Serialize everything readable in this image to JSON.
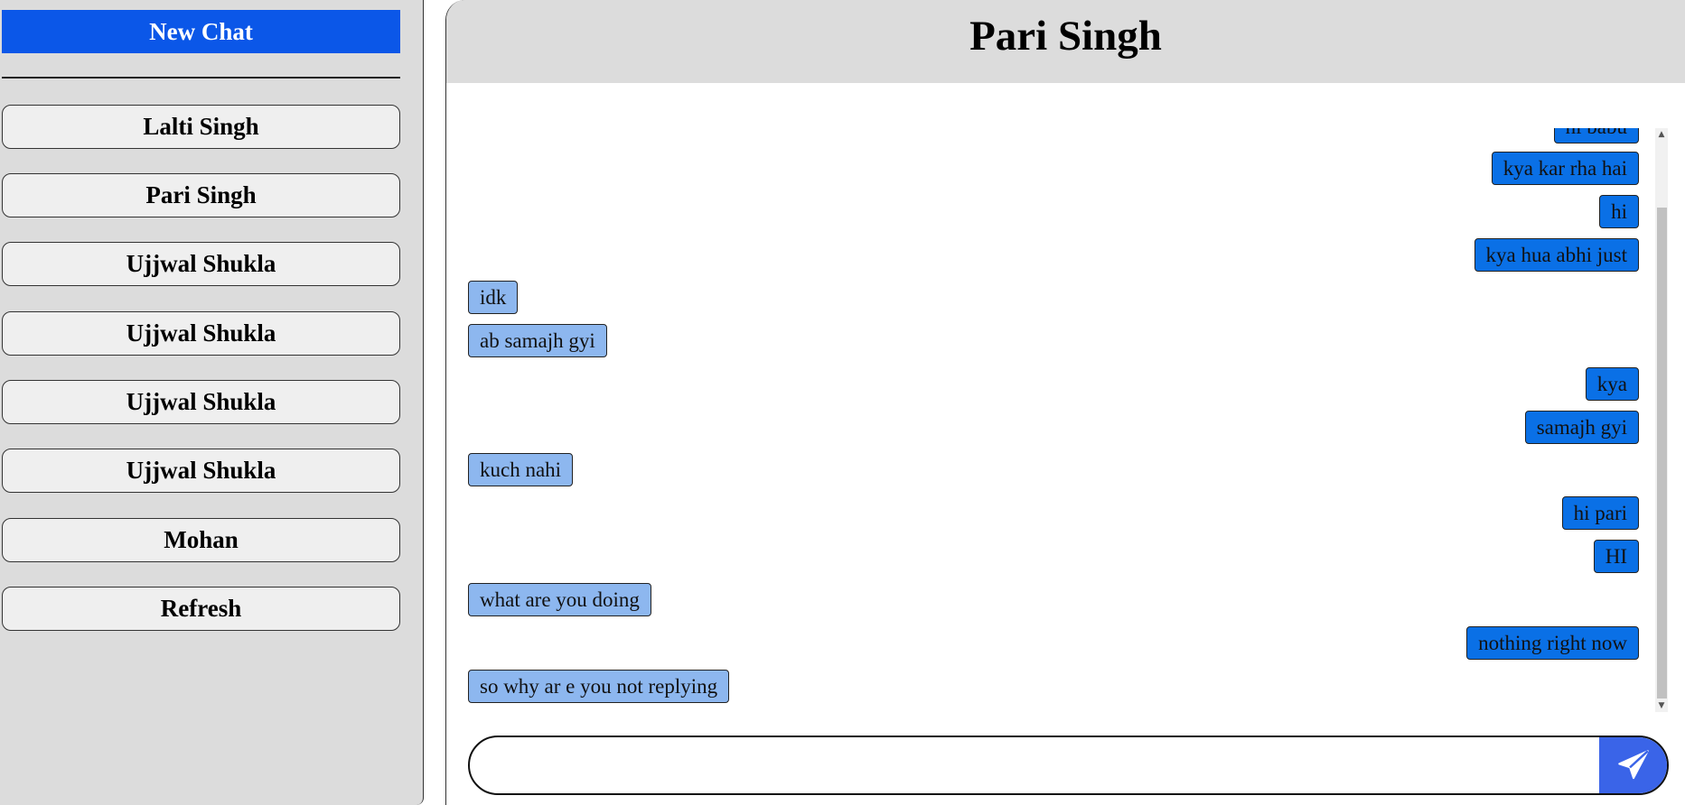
{
  "sidebar": {
    "new_chat_label": "New Chat",
    "contacts": [
      {
        "label": "Lalti Singh"
      },
      {
        "label": "Pari Singh"
      },
      {
        "label": "Ujjwal Shukla"
      },
      {
        "label": "Ujjwal Shukla"
      },
      {
        "label": "Ujjwal Shukla"
      },
      {
        "label": "Ujjwal Shukla"
      },
      {
        "label": "Mohan"
      }
    ],
    "refresh_label": "Refresh"
  },
  "chat": {
    "title": "Pari Singh",
    "messages": [
      {
        "text": "hi babu",
        "side": "out"
      },
      {
        "text": "kya kar rha hai",
        "side": "out"
      },
      {
        "text": "hi",
        "side": "out"
      },
      {
        "text": "kya hua abhi just",
        "side": "out"
      },
      {
        "text": "idk",
        "side": "in"
      },
      {
        "text": "ab samajh gyi",
        "side": "in"
      },
      {
        "text": "kya",
        "side": "out"
      },
      {
        "text": "samajh gyi",
        "side": "out"
      },
      {
        "text": "kuch nahi",
        "side": "in"
      },
      {
        "text": "hi pari",
        "side": "out"
      },
      {
        "text": "HI",
        "side": "out"
      },
      {
        "text": "what are you doing",
        "side": "in"
      },
      {
        "text": "nothing right now",
        "side": "out"
      },
      {
        "text": "so why ar e you not replying",
        "side": "in"
      }
    ]
  },
  "composer": {
    "value": "",
    "placeholder": "",
    "send_icon": "paper-plane-icon"
  },
  "colors": {
    "new_chat_bg": "#0b57e8",
    "outgoing_bubble": "#0a70e6",
    "incoming_bubble": "#8db7ef",
    "send_button": "#3a64e8",
    "panel_grey": "#dcdcdc"
  }
}
